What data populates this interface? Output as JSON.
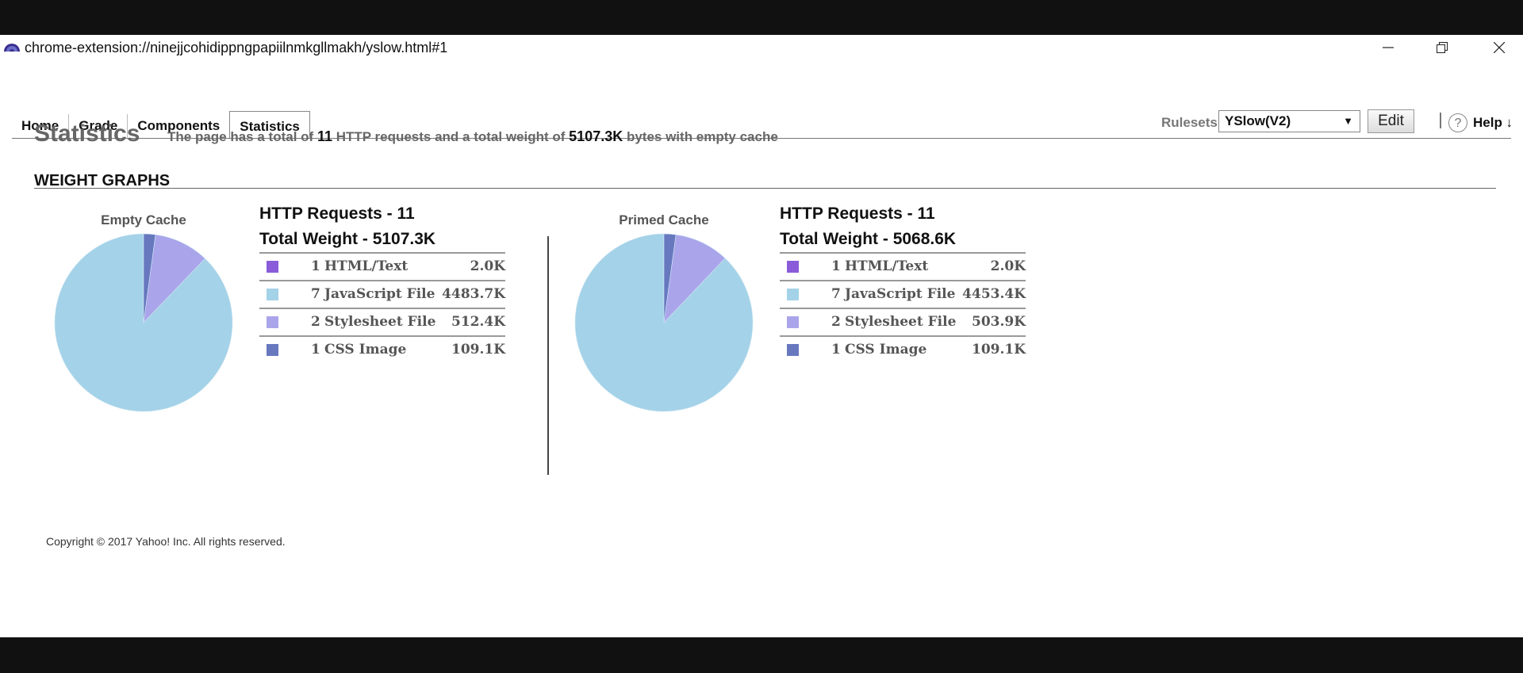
{
  "window": {
    "url": "chrome-extension://ninejjcohidippngpapiilnmkgllmakh/yslow.html#1"
  },
  "nav": {
    "tabs": [
      {
        "label": "Home"
      },
      {
        "label": "Grade"
      },
      {
        "label": "Components"
      },
      {
        "label": "Statistics",
        "active": true
      }
    ],
    "rulesets_label": "Rulesets",
    "ruleset_selected": "YSlow(V2)",
    "edit_label": "Edit",
    "help_label": "Help ↓",
    "help_icon": "?"
  },
  "main": {
    "title": "Statistics",
    "summary": {
      "prefix": "The page has a total of",
      "requests": "11",
      "middle": "HTTP requests and a total weight of",
      "weight": "5107.3K",
      "suffix": "bytes with empty cache"
    },
    "section_title": "WEIGHT GRAPHS",
    "footer": "Copyright © 2017 Yahoo! Inc. All rights reserved."
  },
  "colors": {
    "html": "#8a5cd9",
    "js": "#a4d2e8",
    "css": "#aaa5ea",
    "cssimg": "#6778bf"
  },
  "chart_data": [
    {
      "type": "pie",
      "title": "Empty Cache",
      "requests_label": "HTTP Requests - 11",
      "weight_label": "Total Weight - 5107.3K",
      "rows": [
        {
          "count": "1",
          "label": "HTML/Text",
          "value": "2.0K",
          "kb": 2.0,
          "color_key": "html"
        },
        {
          "count": "7",
          "label": "JavaScript File",
          "value": "4483.7K",
          "kb": 4483.7,
          "color_key": "js"
        },
        {
          "count": "2",
          "label": "Stylesheet File",
          "value": "512.4K",
          "kb": 512.4,
          "color_key": "css"
        },
        {
          "count": "1",
          "label": "CSS Image",
          "value": "109.1K",
          "kb": 109.1,
          "color_key": "cssimg"
        }
      ]
    },
    {
      "type": "pie",
      "title": "Primed Cache",
      "requests_label": "HTTP Requests - 11",
      "weight_label": "Total Weight - 5068.6K",
      "rows": [
        {
          "count": "1",
          "label": "HTML/Text",
          "value": "2.0K",
          "kb": 2.0,
          "color_key": "html"
        },
        {
          "count": "7",
          "label": "JavaScript File",
          "value": "4453.4K",
          "kb": 4453.4,
          "color_key": "js"
        },
        {
          "count": "2",
          "label": "Stylesheet File",
          "value": "503.9K",
          "kb": 503.9,
          "color_key": "css"
        },
        {
          "count": "1",
          "label": "CSS Image",
          "value": "109.1K",
          "kb": 109.1,
          "color_key": "cssimg"
        }
      ]
    }
  ]
}
